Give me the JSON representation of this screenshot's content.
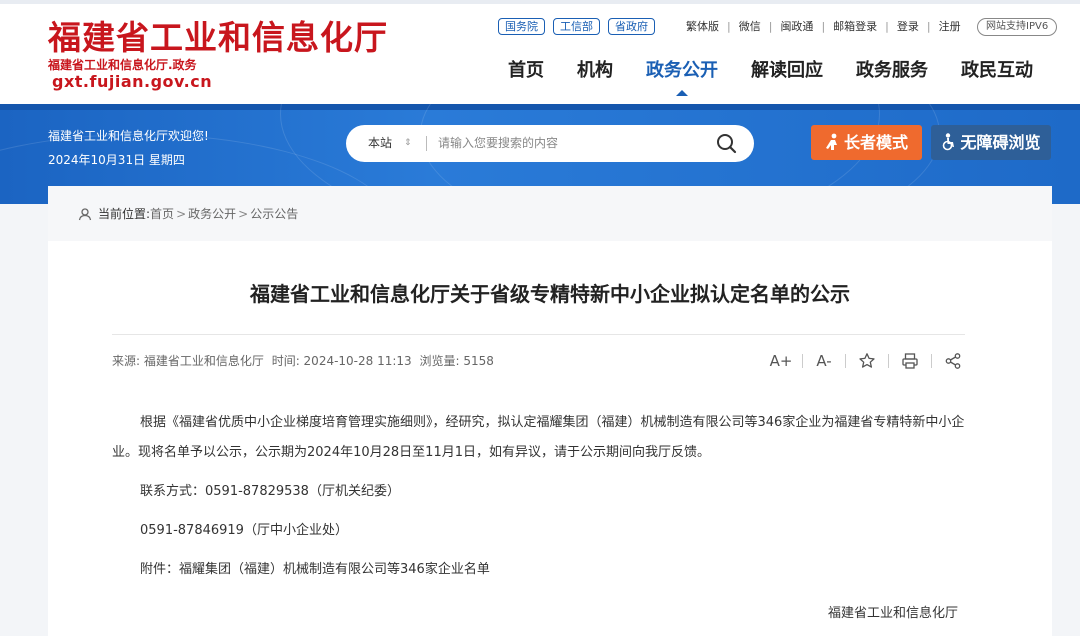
{
  "header": {
    "logo_title": "福建省工业和信息化厅",
    "logo_sub": "福建省工业和信息化厅.政务",
    "logo_domain": "gxt.fujian.gov.cn",
    "gov_links": [
      "国务院",
      "工信部",
      "省政府"
    ],
    "util_links": [
      "繁体版",
      "微信",
      "闽政通",
      "邮箱登录",
      "登录",
      "注册"
    ],
    "ipv6": "网站支持IPV6",
    "nav": [
      "首页",
      "机构",
      "政务公开",
      "解读回应",
      "政务服务",
      "政民互动"
    ],
    "nav_active_index": 2
  },
  "banner": {
    "welcome": "福建省工业和信息化厅欢迎您!",
    "date": "2024年10月31日 星期四",
    "search_scope": "本站",
    "search_placeholder": "请输入您要搜索的内容",
    "elder_mode": "长者模式",
    "accessible": "无障碍浏览"
  },
  "breadcrumb": {
    "label": "当前位置:",
    "items": [
      "首页",
      "政务公开",
      "公示公告"
    ]
  },
  "article": {
    "title": "福建省工业和信息化厅关于省级专精特新中小企业拟认定名单的公示",
    "source": "来源: 福建省工业和信息化厅",
    "time": "时间: 2024-10-28 11:13",
    "views": "浏览量: 5158",
    "tools": [
      "A+",
      "A-",
      "favorite-icon",
      "print-icon",
      "share-icon"
    ],
    "paragraph": "根据《福建省优质中小企业梯度培育管理实施细则》，经研究，拟认定福耀集团（福建）机械制造有限公司等346家企业为福建省专精特新中小企业。现将名单予以公示，公示期为2024年10月28日至11月1日，如有异议，请于公示期间向我厅反馈。",
    "contact": "联系方式：0591-87829538（厅机关纪委）",
    "contact2": "0591-87846919（厅中小企业处）",
    "attachment": "附件：福耀集团（福建）机械制造有限公司等346家企业名单",
    "signature": "福建省工业和信息化厅"
  },
  "colors": {
    "brand_red": "#c8161d",
    "primary_blue": "#1a5fb4",
    "elder_orange": "#ef6a2e",
    "access_blue": "#2e5f98"
  }
}
